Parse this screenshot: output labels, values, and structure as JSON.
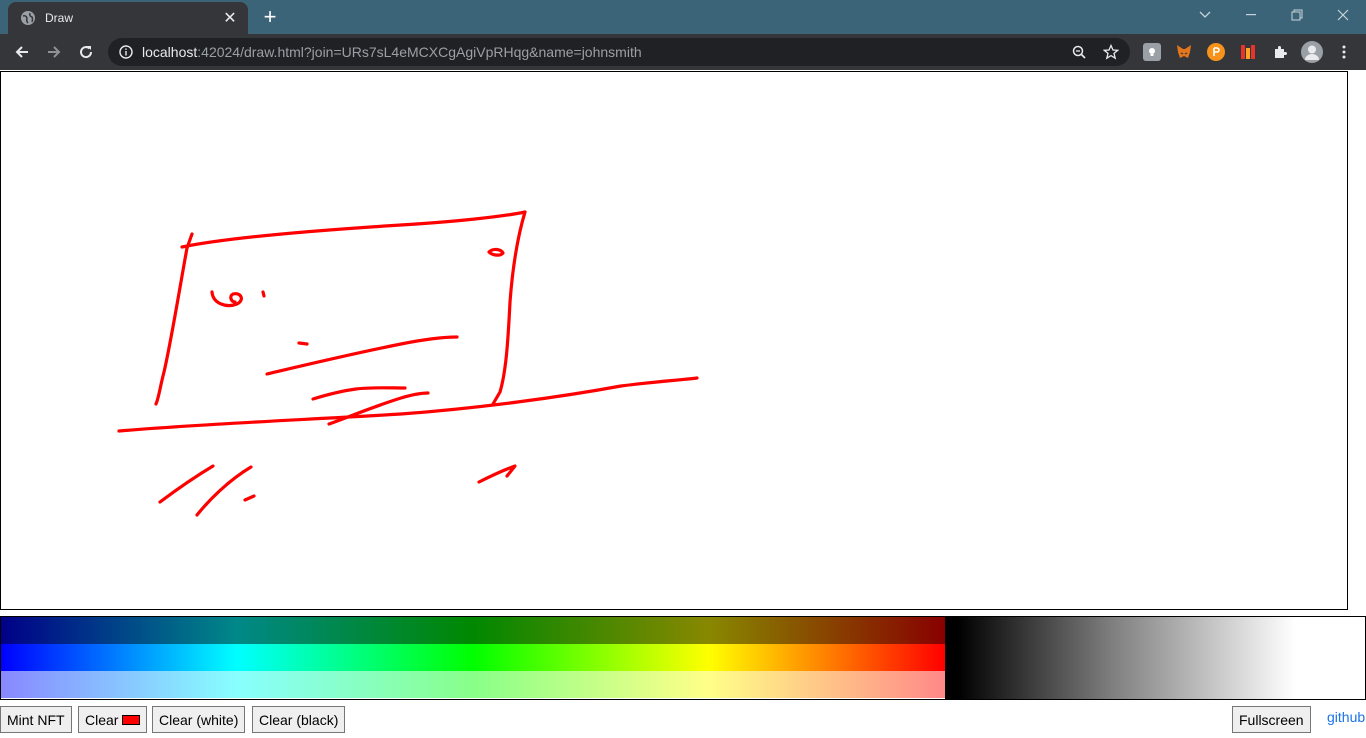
{
  "browser": {
    "tab_title": "Draw",
    "tab_close": "✕",
    "new_tab": "+",
    "url_host": "localhost",
    "url_rest": ":42024/draw.html?join=URs7sL4eMCXCgAgiVpRHqg&name=johnsmith"
  },
  "colors": {
    "tabstrip": "#3c6478",
    "toolbar": "#35363a",
    "stroke": "#ff0000"
  },
  "palette": {
    "rows": [
      "#000088,#008888,#008800,#888800,#880000",
      "#0000ff,#00ffff,#00ff00,#ffff00,#ff0000",
      "#8888ff,#88ffff,#88ff88,#ffff88,#ff8888"
    ]
  },
  "buttons": {
    "mint_nft": "Mint NFT",
    "clear": "Clear",
    "clear_white": "Clear (white)",
    "clear_black": "Clear (black)",
    "fullscreen": "Fullscreen"
  },
  "links": {
    "github": "github"
  }
}
